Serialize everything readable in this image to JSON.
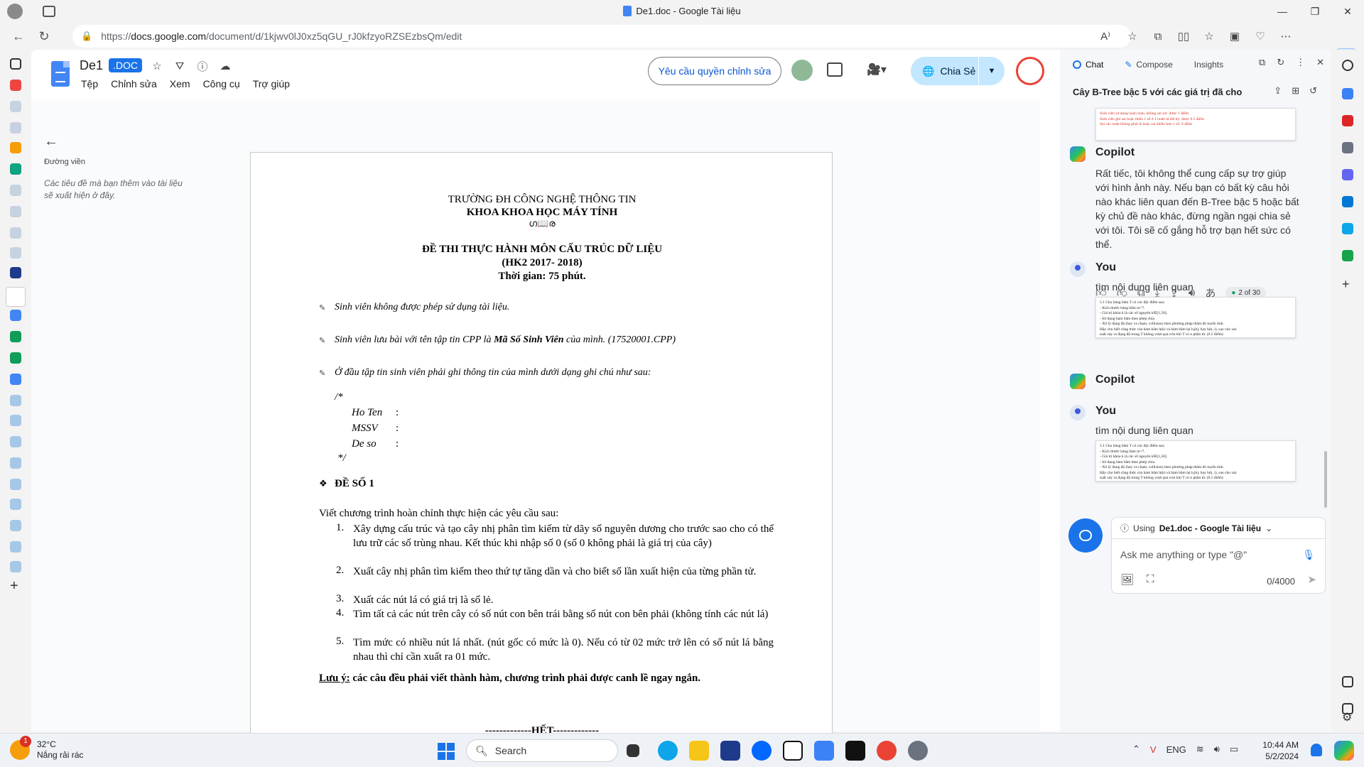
{
  "window": {
    "title": "De1.doc - Google Tài liệu"
  },
  "browser": {
    "url_prefix": "https://",
    "url_host": "docs.google.com",
    "url_path": "/document/d/1kjwv0lJ0xz5qGU_rJ0kfzyoRZSEzbsQm/edit"
  },
  "docs": {
    "doc_name": "De1",
    "doc_badge": ".DOC",
    "menu": [
      "Tệp",
      "Chỉnh sửa",
      "Xem",
      "Công cụ",
      "Trợ giúp"
    ],
    "request_edit": "Yêu cầu quyền chỉnh sửa",
    "share": "Chia Sẻ",
    "outline_title": "Đường viền",
    "outline_hint": "Các tiêu đề mà bạn thêm vào tài liệu sẽ xuất hiện ở đây."
  },
  "page": {
    "school": "TRƯỜNG ĐH CÔNG NGHỆ THÔNG TIN",
    "faculty": "KHOA KHOA HỌC MÁY TÍNH",
    "ornament": "ഗ📖ര",
    "exam_title": "ĐỀ THI THỰC HÀNH MÔN CẤU TRÚC DỮ LIỆU",
    "semester": "(HK2 2017- 2018)",
    "time": "Thời gian: 75 phút.",
    "instr1": "Sinh viên không được phép sử dụng tài liệu.",
    "instr2_a": "Sinh viên lưu bài với tên tập tin CPP là ",
    "instr2_b": "Mã Số Sinh Viên",
    "instr2_c": " của mình. (17520001.CPP)",
    "instr3": "Ở đầu tập tin sinh viên phải ghi thông tin của mình dưới dạng ghi chú như sau:",
    "comment_open": "/*",
    "field1": "Ho Ten",
    "field2": "MSSV",
    "field3": "De so",
    "colon": ":",
    "comment_close": "*/",
    "section_bullet": "❖",
    "section": "ĐỀ SỐ 1",
    "intro": "Viết chương trình hoàn chỉnh thực hiện các yêu cầu sau:",
    "items": [
      {
        "num": "1.",
        "text": "Xây dựng cấu trúc và tạo cây nhị phân tìm kiếm từ dãy số nguyên dương cho trước sao cho có thể lưu trữ các số trùng nhau. Kết thúc khi nhập số 0 (số 0 không phải là giá trị của cây)"
      },
      {
        "num": "2.",
        "text": "Xuất cây nhị phân tìm kiếm theo thứ tự tăng dần và cho biết số lần xuất hiện của từng phần tử."
      },
      {
        "num": "3.",
        "text": "Xuất các nút lá có giá trị là số lẻ."
      },
      {
        "num": "4.",
        "text": "Tìm tất cả các nút trên cây có số nút con bên trái bằng số nút con bên phải (không tính các nút lá)"
      },
      {
        "num": "5.",
        "text": "Tìm mức có nhiều nút lá nhất. (nút gốc có mức là 0). Nếu có từ 02 mức trở lên có số nút lá bằng nhau thì chỉ cần xuất ra 01 mức."
      }
    ],
    "note_label": "Lưu ý:",
    "note_text": " các câu đều phải viết thành hàm, chương trình phải được canh lề ngay ngắn.",
    "end": "-------------HẾT-------------"
  },
  "copilot": {
    "tabs": [
      "Chat",
      "Compose",
      "Insights"
    ],
    "conversation_title": "Cây B-Tree bậc 5 với các giá trị đã cho",
    "thumb_top_lines": [
      "Sinh viên sử dụng hoàn toàn, không sai sót: được 1 điểm",
      "Sinh viên ghi sai hoặc thiếu 1 số ở 1 node lá bất kỳ: được 0.5 điểm",
      "Sai các node không phải là hoặc sai nhiều hơn 1 số: 0 điểm"
    ],
    "copilot_name": "Copilot",
    "copilot_reply": "Rất tiếc, tôi không thể cung cấp sự trợ giúp với hình ảnh này. Nếu bạn có bất kỳ câu hỏi nào khác liên quan đến B-Tree bậc 5 hoặc bất kỳ chủ đề nào khác, đừng ngần ngại chia sẻ với tôi. Tôi sẽ cố gắng hỗ trợ bạn hết sức có thể.",
    "page_indicator": "2 of 30",
    "user_name": "You",
    "user_msg": "tìm nội dung liên quan",
    "thumb_q_lines": [
      "5.1 Cho bảng băm T có các đặc điểm sau:",
      "- Kích thước bảng băm m=7.",
      "- Giá trị khóa k là các số nguyên k∈[1,50].",
      "- Sử dụng hàm băm theo phép chia.",
      "- Xử lý đụng độ (hay va chạm, collision) theo phương pháp thăm dò tuyến tính.",
      "Hãy cho biết công thức của hàm băm h(k) và hàm băm lại hᵢ(k), hay h(k, i), sao cho xác",
      "suất xảy ra đụng độ trong T không vượt quá n/m khi T có n phần tử. (0.5 điểm)"
    ],
    "using_label": "Using ",
    "using_doc": "De1.doc - Google Tài liệu",
    "input_placeholder": "Ask me anything or type \"@\"",
    "counter": "0/4000"
  },
  "taskbar": {
    "weather_badge": "1",
    "temperature": "32°C",
    "weather_desc": "Nắng rải rác",
    "search": "Search",
    "language": "ENG",
    "time": "10:44 AM",
    "date": "5/2/2024"
  }
}
